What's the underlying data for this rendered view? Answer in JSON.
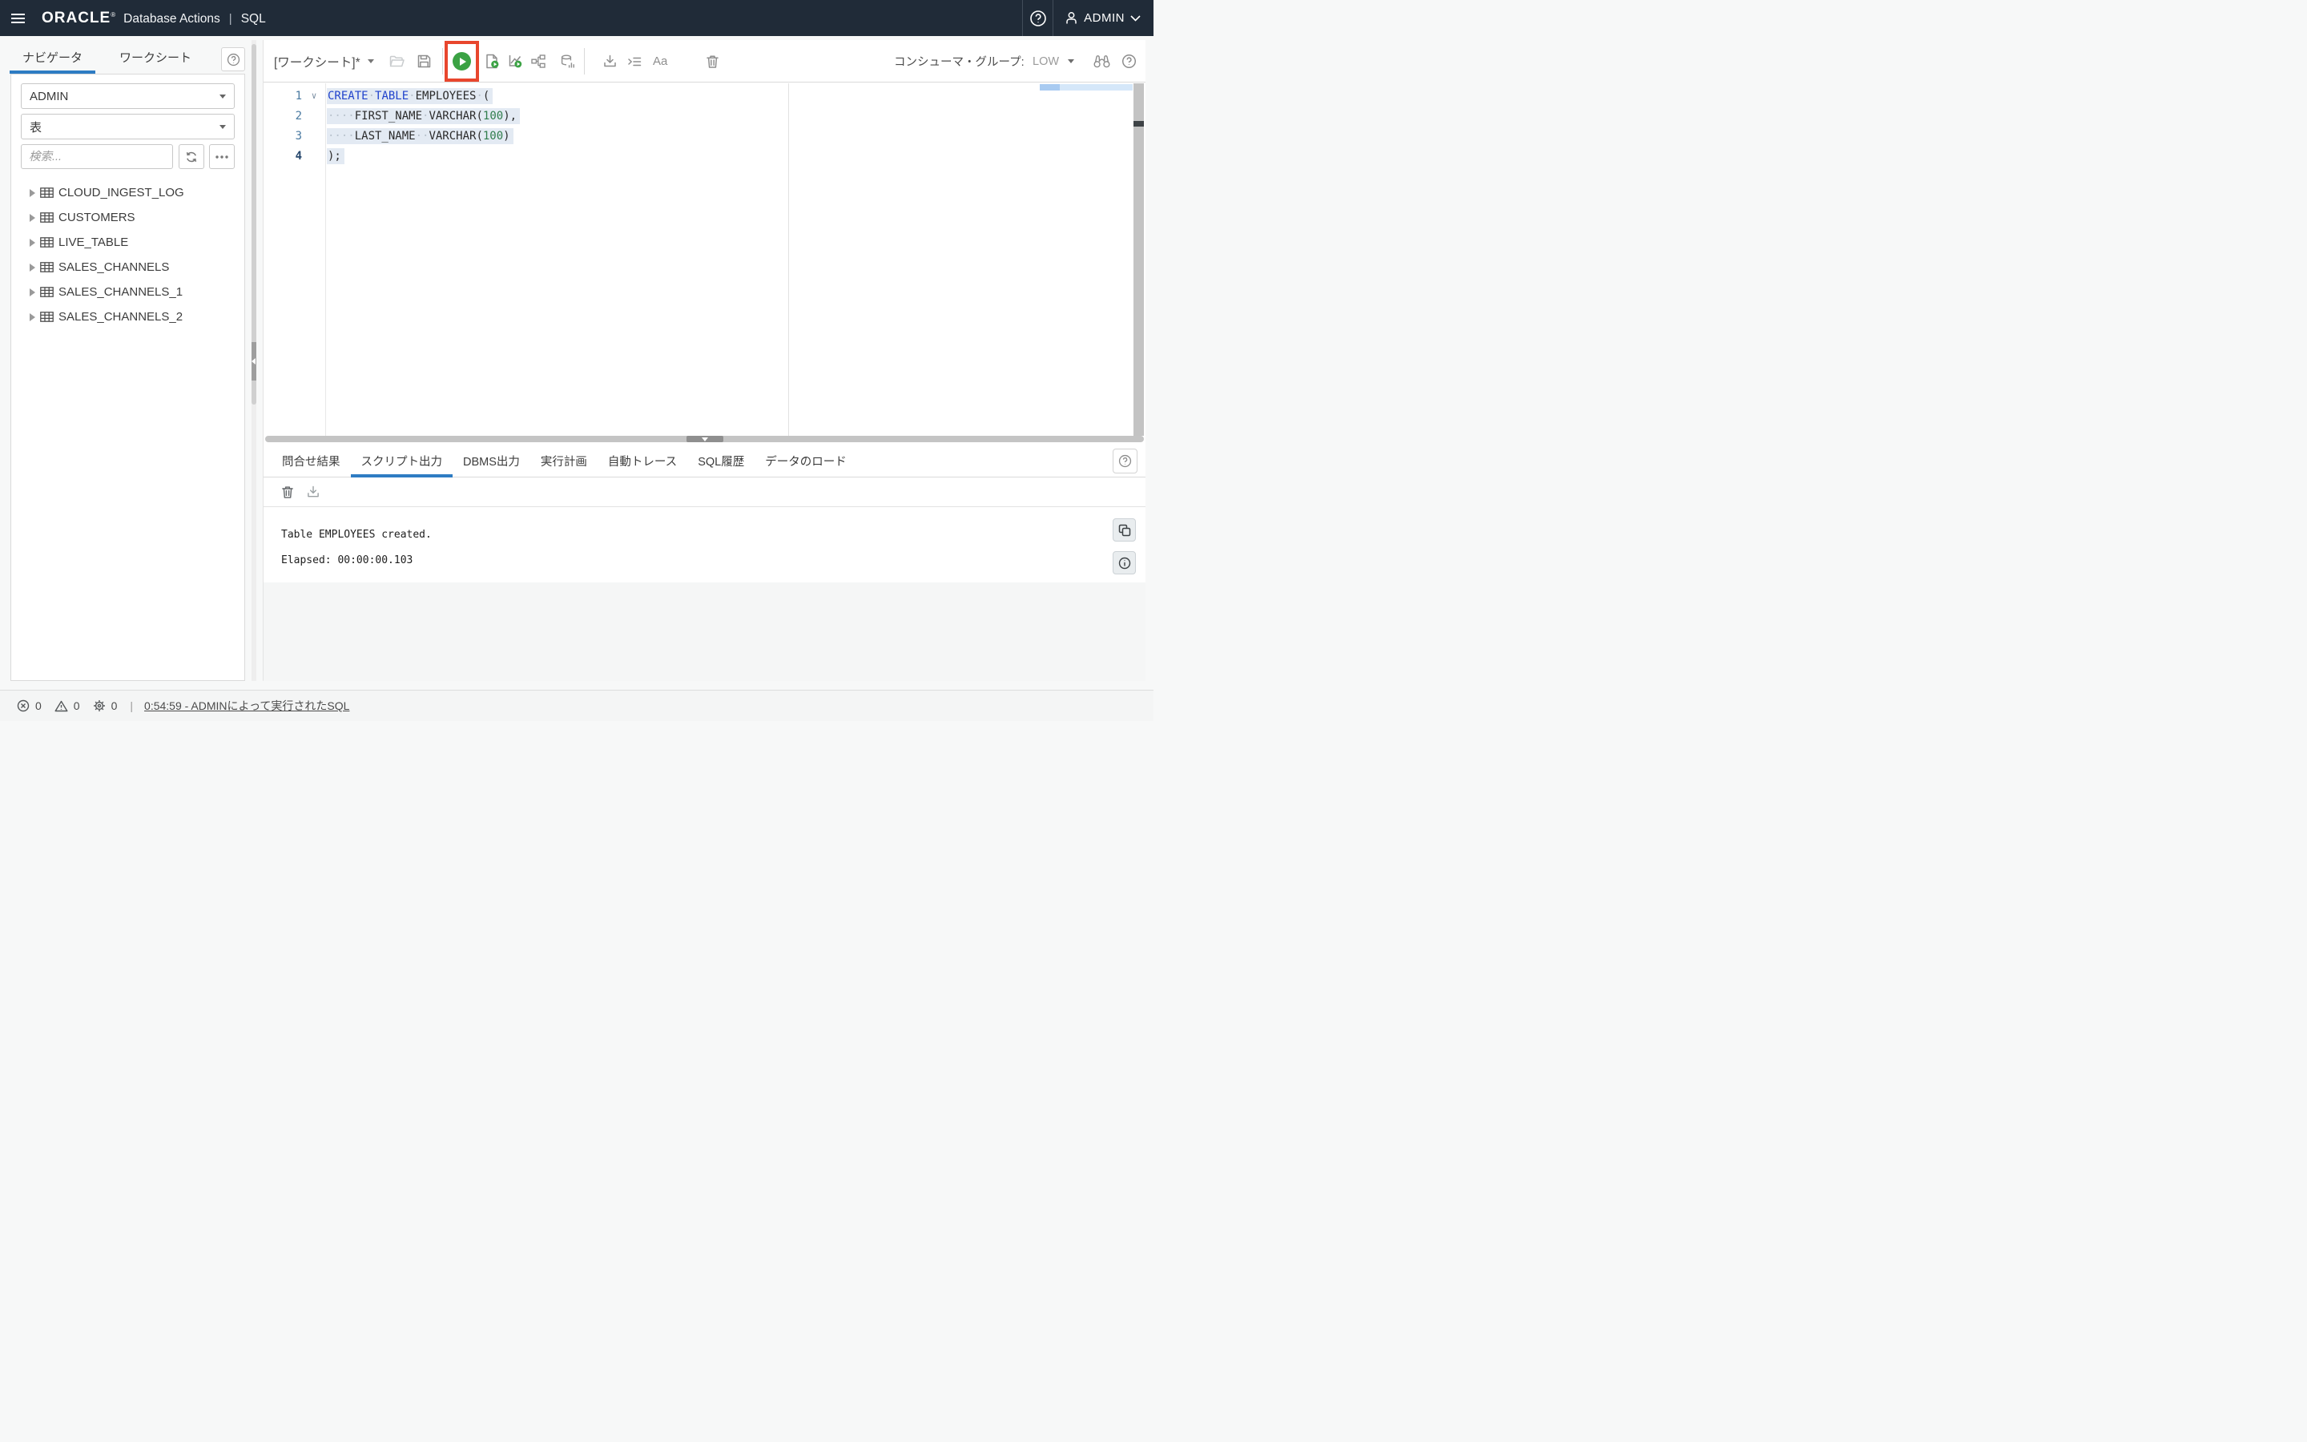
{
  "colors": {
    "header_bg": "#202b38",
    "accent_blue": "#2e7cc3",
    "run_green": "#3ba244",
    "annotation_red": "#e8462d",
    "keyword_blue": "#2143cc",
    "number_green": "#307d4c",
    "selection_bg": "#e3eaf3"
  },
  "header": {
    "logo": "ORACLE",
    "logo_reg": "®",
    "product": "Database Actions",
    "pipe": "|",
    "app": "SQL",
    "user": "ADMIN"
  },
  "sidebar": {
    "tabs": [
      {
        "label": "ナビゲータ",
        "active": true
      },
      {
        "label": "ワークシート",
        "active": false
      }
    ],
    "schema_select_value": "ADMIN",
    "object_type_select_value": "表",
    "search_placeholder": "検索...",
    "tables": [
      "CLOUD_INGEST_LOG",
      "CUSTOMERS",
      "LIVE_TABLE",
      "SALES_CHANNELS",
      "SALES_CHANNELS_1",
      "SALES_CHANNELS_2"
    ]
  },
  "toolbar": {
    "worksheet_title": "[ワークシート]*",
    "font_button_label": "Aa",
    "consumer_group_label": "コンシューマ・グループ:",
    "consumer_group_value": "LOW"
  },
  "editor": {
    "lines": [
      {
        "num": "1",
        "fold": "∨",
        "selected": true,
        "tokens": [
          {
            "t": "kw",
            "v": "CREATE"
          },
          {
            "t": "ws",
            "v": "·"
          },
          {
            "t": "kw",
            "v": "TABLE"
          },
          {
            "t": "ws",
            "v": "·"
          },
          {
            "t": "pl",
            "v": "EMPLOYEES"
          },
          {
            "t": "ws",
            "v": "·"
          },
          {
            "t": "pl",
            "v": "("
          }
        ]
      },
      {
        "num": "2",
        "fold": "",
        "selected": true,
        "tokens": [
          {
            "t": "ws",
            "v": "····"
          },
          {
            "t": "pl",
            "v": "FIRST_NAME"
          },
          {
            "t": "ws",
            "v": "·"
          },
          {
            "t": "pl",
            "v": "VARCHAR("
          },
          {
            "t": "num",
            "v": "100"
          },
          {
            "t": "pl",
            "v": "),"
          }
        ]
      },
      {
        "num": "3",
        "fold": "",
        "selected": true,
        "tokens": [
          {
            "t": "ws",
            "v": "····"
          },
          {
            "t": "pl",
            "v": "LAST_NAME"
          },
          {
            "t": "ws",
            "v": "··"
          },
          {
            "t": "pl",
            "v": "VARCHAR("
          },
          {
            "t": "num",
            "v": "100"
          },
          {
            "t": "pl",
            "v": ")"
          }
        ]
      },
      {
        "num": "4",
        "fold": "",
        "selected": true,
        "tokens": [
          {
            "t": "pl",
            "v": ");"
          }
        ]
      }
    ]
  },
  "output": {
    "tabs": [
      {
        "label": "問合せ結果",
        "active": false
      },
      {
        "label": "スクリプト出力",
        "active": true
      },
      {
        "label": "DBMS出力",
        "active": false
      },
      {
        "label": "実行計画",
        "active": false
      },
      {
        "label": "自動トレース",
        "active": false
      },
      {
        "label": "SQL履歴",
        "active": false
      },
      {
        "label": "データのロード",
        "active": false
      }
    ],
    "messages": [
      "Table EMPLOYEES created.",
      "Elapsed: 00:00:00.103"
    ]
  },
  "statusbar": {
    "errors": "0",
    "warnings": "0",
    "tasks": "0",
    "pipe": "|",
    "link": "0:54:59 - ADMINによって実行されたSQL"
  }
}
